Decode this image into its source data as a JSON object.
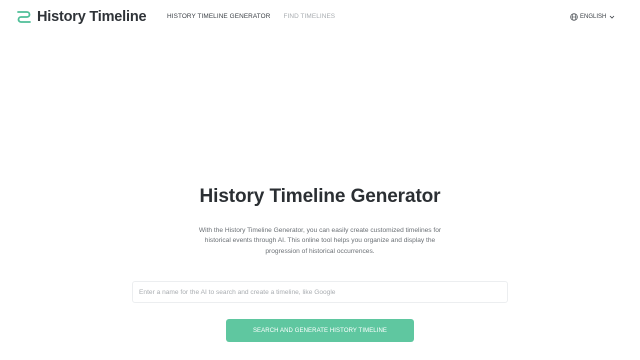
{
  "header": {
    "logo_text": "History Timeline",
    "nav": [
      {
        "label": "HISTORY TIMELINE GENERATOR",
        "active": true
      },
      {
        "label": "FIND TIMELINES",
        "active": false
      }
    ],
    "language": {
      "label": "ENGLISH",
      "icon": "globe-icon"
    }
  },
  "hero": {
    "title": "History Timeline Generator",
    "description": "With the History Timeline Generator, you can easily create customized timelines for historical events through AI. This online tool helps you organize and display the progression of historical occurrences."
  },
  "search": {
    "value": "",
    "placeholder": "Enter a name for the AI to search and create a timeline, like Google"
  },
  "cta": {
    "label": "SEARCH AND GENERATE HISTORY TIMELINE"
  },
  "colors": {
    "accent": "#5fc7a0",
    "text_dark": "#2b2f33",
    "text_muted": "#a8acb0"
  }
}
